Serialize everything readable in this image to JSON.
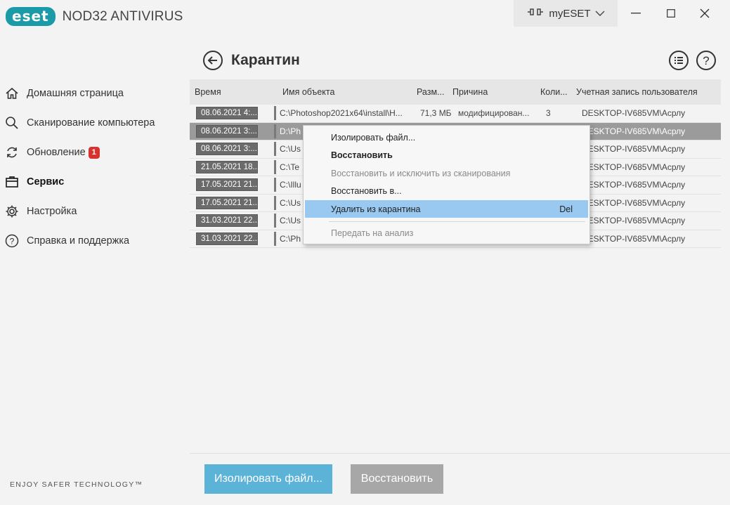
{
  "app": {
    "logo_text": "eset",
    "product": "NOD32 ANTIVIRUS",
    "myeset_label": "myESET"
  },
  "window_controls": {
    "minimize": "—",
    "maximize": "☐",
    "close": "✕"
  },
  "sidebar": {
    "items": [
      {
        "label": "Домашняя страница",
        "icon": "home-icon"
      },
      {
        "label": "Сканирование компьютера",
        "icon": "search-icon"
      },
      {
        "label": "Обновление",
        "icon": "refresh-icon",
        "badge": "1"
      },
      {
        "label": "Сервис",
        "icon": "briefcase-icon",
        "active": true
      },
      {
        "label": "Настройка",
        "icon": "gear-icon"
      },
      {
        "label": "Справка и поддержка",
        "icon": "help-icon"
      }
    ],
    "tagline": "ENJOY SAFER TECHNOLOGY™"
  },
  "page": {
    "title": "Карантин"
  },
  "table": {
    "headers": [
      "Время",
      "Имя объекта",
      "Разм...",
      "Причина",
      "Коли...",
      "Учетная запись пользователя"
    ],
    "rows": [
      {
        "time": "08.06.2021 4:...",
        "name": "C:\\Photoshop2021x64\\install\\H...",
        "size": "71,3 МБ",
        "reason": "модифицирован...",
        "count": "3",
        "user": "DESKTOP-IV685VM\\Асрлу"
      },
      {
        "time": "08.06.2021 3:...",
        "name": "D:\\Ph",
        "size": "",
        "reason": "",
        "count": "",
        "user": "DESKTOP-IV685VM\\Асрлу",
        "selected": true
      },
      {
        "time": "08.06.2021 3:...",
        "name": "C:\\Us",
        "size": "",
        "reason": "",
        "count": "",
        "user": "DESKTOP-IV685VM\\Асрлу"
      },
      {
        "time": "21.05.2021 18...",
        "name": "C:\\Te",
        "size": "",
        "reason": "",
        "count": "",
        "user": "DESKTOP-IV685VM\\Асрлу"
      },
      {
        "time": "17.05.2021 21...",
        "name": "C:\\Illu",
        "size": "",
        "reason": "",
        "count": "",
        "user": "DESKTOP-IV685VM\\Асрлу"
      },
      {
        "time": "17.05.2021 21...",
        "name": "C:\\Us",
        "size": "",
        "reason": "",
        "count": "",
        "user": "DESKTOP-IV685VM\\Асрлу"
      },
      {
        "time": "31.03.2021 22...",
        "name": "C:\\Us",
        "size": "",
        "reason": "",
        "count": "",
        "user": "DESKTOP-IV685VM\\Асрлу"
      },
      {
        "time": "31.03.2021 22...",
        "name": "C:\\Ph",
        "size": "",
        "reason": "",
        "count": "",
        "user": "DESKTOP-IV685VM\\Асрлу"
      }
    ]
  },
  "context_menu": {
    "items": [
      {
        "label": "Изолировать файл..."
      },
      {
        "label": "Восстановить",
        "bold": true
      },
      {
        "label": "Восстановить и исключить из сканирования",
        "disabled": true
      },
      {
        "label": "Восстановить в..."
      },
      {
        "label": "Удалить из карантина",
        "shortcut": "Del",
        "highlighted": true
      },
      {
        "label": "Передать на анализ",
        "disabled": true
      }
    ]
  },
  "footer": {
    "primary_button": "Изолировать файл...",
    "secondary_button": "Восстановить"
  },
  "colors": {
    "brand": "#1b9aa8",
    "primary_button": "#5bb3d8",
    "badge": "#d9312b",
    "menu_highlight": "#99c9f0"
  }
}
